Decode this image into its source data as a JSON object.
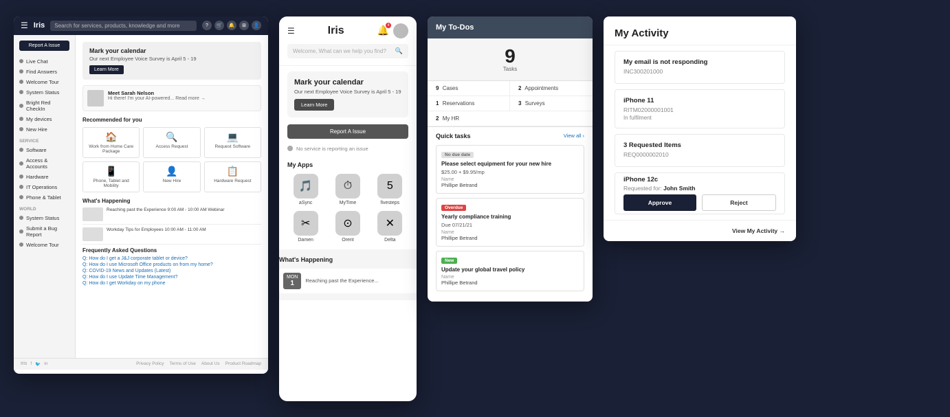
{
  "panel1": {
    "logo": "Iris",
    "search_placeholder": "Search for services, products, knowledge and more",
    "sidebar": {
      "btn_report": "Report A Issue",
      "items": [
        {
          "label": "Live Chat"
        },
        {
          "label": "Find Answers"
        },
        {
          "label": "Welcome Tour"
        },
        {
          "label": "System Status"
        },
        {
          "label": "Bright Red CheckIn"
        },
        {
          "label": "My devices"
        },
        {
          "label": "New Hire"
        },
        {
          "section": "SERVICE"
        },
        {
          "label": "Software"
        },
        {
          "label": "Access & Accounts"
        },
        {
          "label": "Hardware"
        },
        {
          "label": "IT Operations"
        },
        {
          "label": "Phone & Tablet"
        },
        {
          "section": "WORLD"
        },
        {
          "label": "System Status"
        },
        {
          "label": "Submit a Bug Report"
        },
        {
          "label": "Welcome Tour"
        }
      ]
    },
    "banner": {
      "title": "Mark your calendar",
      "subtitle": "Our next Employee Voice Survey is April 5 - 19",
      "btn": "Learn More"
    },
    "recommended": {
      "title": "Recommended for you",
      "items": [
        {
          "icon": "🏠",
          "label": "Work from Home Care Package"
        },
        {
          "icon": "🔍",
          "label": "Access Request"
        },
        {
          "icon": "💻",
          "label": "Request Software"
        },
        {
          "icon": "📱",
          "label": "Phone, Tablet and Mobility"
        },
        {
          "icon": "👤",
          "label": "New Hire"
        },
        {
          "icon": "📋",
          "label": "Hardware Request"
        }
      ]
    },
    "whats_happening": {
      "title": "What's Happening",
      "items": [
        {
          "text": "Reaching past the Experience 9:00 AM - 10:00 AM Webinar"
        },
        {
          "text": "Workday Tips for Employees 10:00 AM - 11:00 AM"
        }
      ]
    },
    "faq": {
      "title": "Frequently Asked Questions",
      "items": [
        "Q: How do I get a J&J corporate tablet or device?",
        "Q: How do I use Microsoft Office products on from my home?",
        "Q: COVID-19 News and Updates (Latest)",
        "Q: How do I use Update Time Management?",
        "Q: How do I get Workday on my phone"
      ]
    },
    "footer_links": [
      "Privacy Policy",
      "Terms of Use",
      "About Us",
      "Product Roadmap"
    ]
  },
  "panel2": {
    "logo": "Iris",
    "bell_count": "4",
    "search_placeholder": "Welcome, What can we help you find?",
    "banner": {
      "title": "Mark your calendar",
      "subtitle": "Our next Employee Voice Survey is April 5 - 19",
      "btn": "Learn More"
    },
    "report_btn": "Report A Issue",
    "no_service": "No service is reporting an issue",
    "my_apps": {
      "title": "My Apps",
      "apps": [
        {
          "icon": "🎵",
          "label": "aSync",
          "bg": "#e8e8e8"
        },
        {
          "icon": "⏱",
          "label": "MyTime",
          "bg": "#e8e8e8"
        },
        {
          "icon": "5️⃣",
          "label": "fivesteps",
          "bg": "#e8e8e8"
        },
        {
          "icon": "✂️",
          "label": "Damen",
          "bg": "#e8e8e8"
        },
        {
          "icon": "⭕",
          "label": "Orent",
          "bg": "#e8e8e8"
        },
        {
          "icon": "✖️",
          "label": "Delta",
          "bg": "#e8e8e8"
        }
      ]
    },
    "whats_happening": {
      "title": "What's Happening",
      "card": {
        "month": "MON",
        "day": "1",
        "desc": "Reaching past the Experience..."
      }
    }
  },
  "panel3": {
    "header": "My To-Dos",
    "tasks_count": "9",
    "tasks_label": "Tasks",
    "stats": [
      {
        "count": "9",
        "label": "Cases"
      },
      {
        "count": "2",
        "label": "Appointments"
      },
      {
        "count": "1",
        "label": "Reservations"
      },
      {
        "count": "3",
        "label": "Surveys"
      },
      {
        "count": "2",
        "label": "My HR"
      }
    ],
    "quick_tasks": {
      "title": "Quick tasks",
      "view_all": "View all",
      "tasks": [
        {
          "badge": "No due date",
          "badge_type": "no-due",
          "title": "Please select equipment for your new hire",
          "price": "$25.00 + $9.95/mp",
          "name_label": "Name",
          "name": "Phillipe Betrand"
        },
        {
          "badge": "Overdue",
          "badge_type": "overdue",
          "title": "Yearly compliance training",
          "due": "Due 07/21/21",
          "name_label": "Name",
          "name": "Phillipe Betrand"
        },
        {
          "badge": "New",
          "badge_type": "new",
          "title": "Update your global travel policy",
          "name_label": "Name",
          "name": "Phillipe Betrand"
        }
      ]
    }
  },
  "panel4": {
    "title": "My Activity",
    "items": [
      {
        "title": "My email is not responding",
        "subtitle": "INC300201000"
      },
      {
        "title": "iPhone 11",
        "subtitle": "RITM02000001001",
        "status": "In fulfilment"
      },
      {
        "title": "3 Requested Items",
        "subtitle": "REQ0000002010"
      }
    ],
    "approval": {
      "title": "iPhone 12c",
      "subtitle": "Requested for:",
      "name": "John Smith",
      "approve_btn": "Approve",
      "reject_btn": "Reject"
    },
    "view_link": "View My Activity →"
  }
}
